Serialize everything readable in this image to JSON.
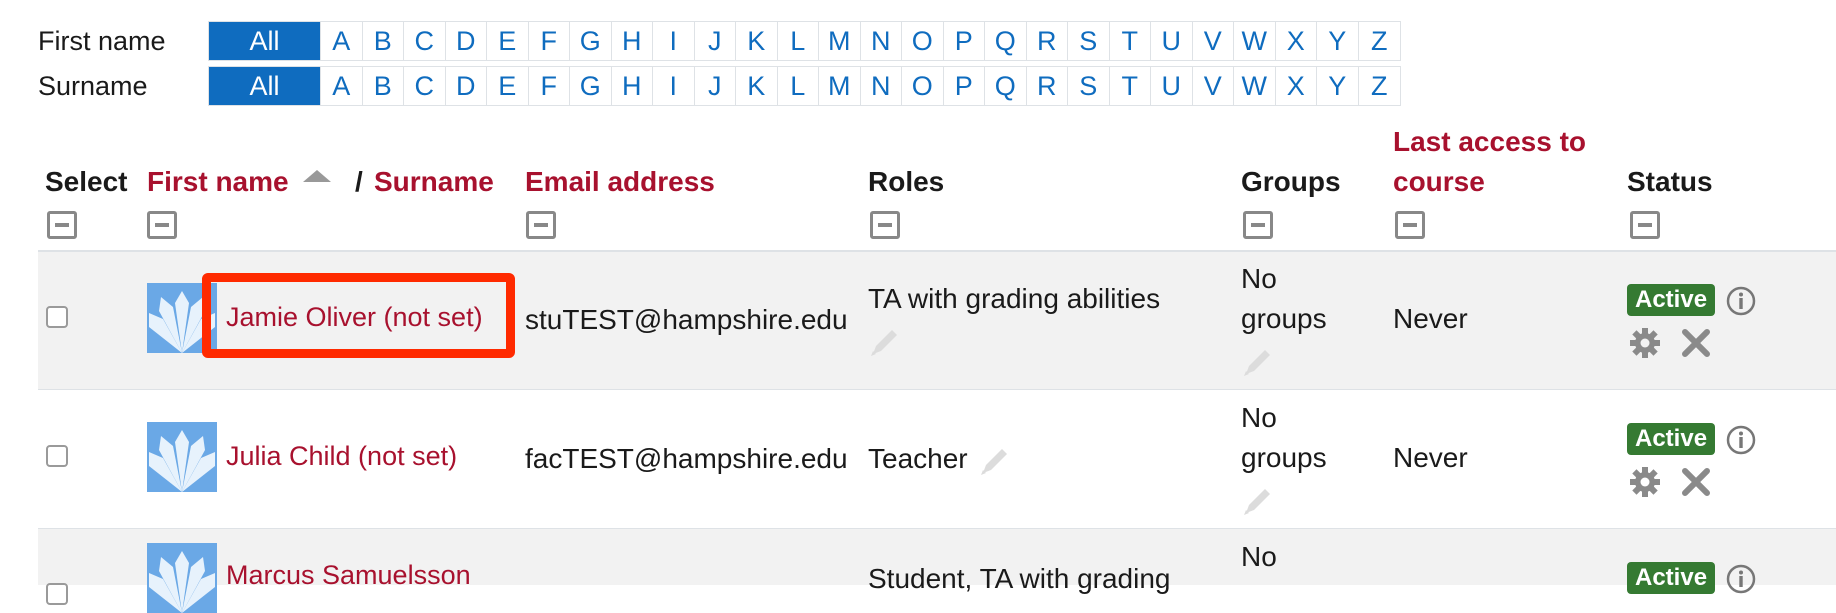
{
  "initials": {
    "first_name_label": "First name",
    "surname_label": "Surname",
    "all_label": "All",
    "letters": [
      "A",
      "B",
      "C",
      "D",
      "E",
      "F",
      "G",
      "H",
      "I",
      "J",
      "K",
      "L",
      "M",
      "N",
      "O",
      "P",
      "Q",
      "R",
      "S",
      "T",
      "U",
      "V",
      "W",
      "X",
      "Y",
      "Z"
    ]
  },
  "table": {
    "headers": {
      "select": "Select",
      "first_name": "First name",
      "separator": "/",
      "surname": "Surname",
      "email": "Email address",
      "roles": "Roles",
      "groups": "Groups",
      "last_access_line1": "Last access to",
      "last_access_line2": "course",
      "status": "Status"
    },
    "rows": [
      {
        "name": "Jamie Oliver (not set)",
        "email": "stuTEST@hampshire.edu",
        "roles": "TA with grading abilities",
        "groups_line1": "No",
        "groups_line2": "groups",
        "last_access": "Never",
        "status": "Active"
      },
      {
        "name": "Julia Child (not set)",
        "email": "facTEST@hampshire.edu",
        "roles": "Teacher",
        "groups_line1": "No",
        "groups_line2": "groups",
        "last_access": "Never",
        "status": "Active"
      },
      {
        "name": "Marcus Samuelsson",
        "roles": "Student, TA with grading",
        "groups_line1": "No",
        "status": "Active"
      }
    ]
  },
  "colors": {
    "link": "#0f6cbf",
    "sort_header": "#a8112e",
    "active_badge": "#357a32",
    "highlight": "#ff2a00"
  }
}
